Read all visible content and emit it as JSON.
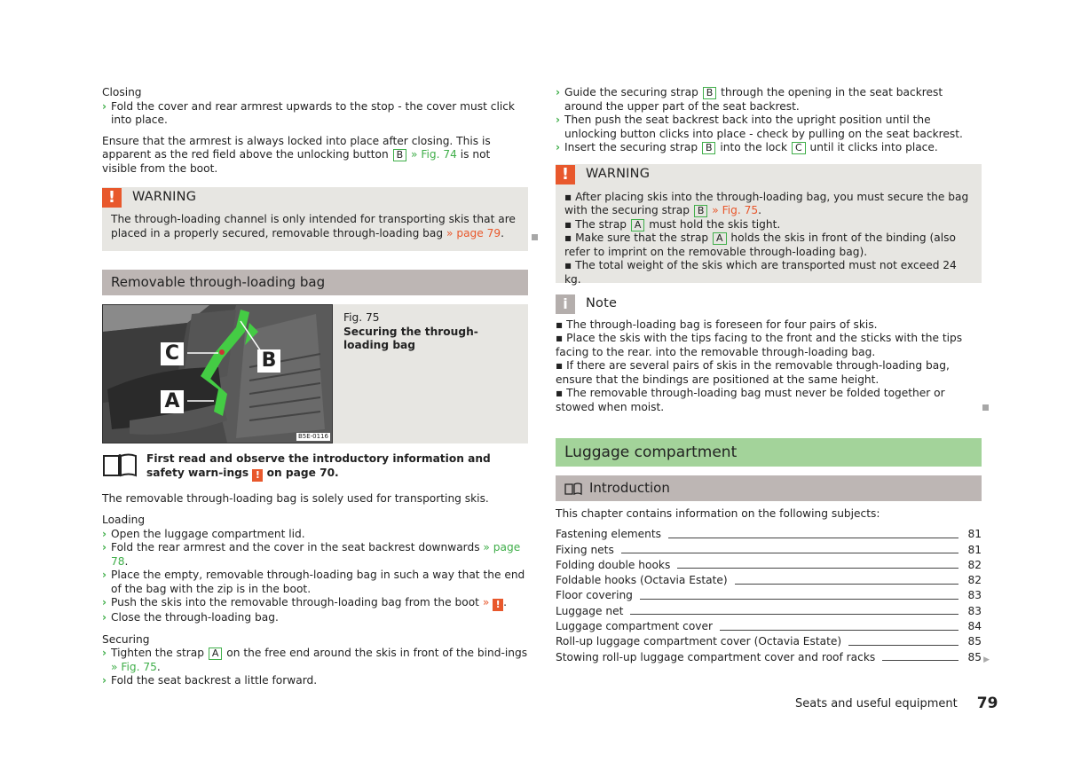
{
  "left": {
    "closing": {
      "heading": "Closing",
      "steps": [
        {
          "text": "Fold the cover and rear armrest upwards to the stop - the cover must click into place."
        }
      ],
      "para_before": "Ensure that the armrest is always locked into place after closing. This is apparent as the red field above the unlocking button ",
      "para_key": "B",
      "para_link": "» Fig. 74",
      "para_after": " is not visible from the boot."
    },
    "warning1": {
      "title": "WARNING",
      "text_before": "The through-loading channel is only intended for transporting skis that are placed in a properly secured, removable through-loading bag ",
      "link": "» page 79",
      "text_after": "."
    },
    "section_title": "Removable through-loading bag",
    "figure": {
      "number": "Fig. 75",
      "caption": "Securing the through-loading bag",
      "labels": [
        "C",
        "B",
        "A"
      ],
      "code": "B5E-0116"
    },
    "intro_note": {
      "text_before": "First read and observe the introductory information and safety warn-ings ",
      "text_after": " on page 70."
    },
    "solely_used": "The removable through-loading bag is solely used for transporting skis.",
    "loading": {
      "heading": "Loading",
      "steps": [
        {
          "text": "Open the luggage compartment lid."
        },
        {
          "text": "Fold the rear armrest and the cover in the seat backrest downwards ",
          "link": "» page 78",
          "after": "."
        },
        {
          "text": "Place the empty, removable through-loading bag in such a way that the end of the bag with the zip is in the boot."
        },
        {
          "text": "Push the skis into the removable through-loading bag from the boot ",
          "link": "»",
          "after": "."
        },
        {
          "text": "Close the through-loading bag."
        }
      ]
    },
    "securing": {
      "heading": "Securing",
      "step1_before": "Tighten the strap ",
      "step1_key": "A",
      "step1_after": " on the free end around the skis in front of the bind-ings ",
      "step1_link": "» Fig. 75",
      "step1_end": ".",
      "step2": "Fold the seat backrest a little forward."
    }
  },
  "right": {
    "steps": {
      "s1_before": "Guide the securing strap ",
      "s1_key": "B",
      "s1_after": " through the opening in the seat backrest around the upper part of the seat backrest.",
      "s2": "Then push the seat backrest back into the upright position until the unlocking button clicks into place - check by pulling on the seat backrest.",
      "s3_before": "Insert the securing strap ",
      "s3_key1": "B",
      "s3_mid": " into the lock ",
      "s3_key2": "C",
      "s3_after": " until it clicks into place."
    },
    "warning2": {
      "title": "WARNING",
      "b1_before": "After placing skis into the through-loading bag, you must secure the bag with the securing strap ",
      "b1_key": "B",
      "b1_link": "» Fig. 75",
      "b1_end": ".",
      "b2_before": "The strap ",
      "b2_key": "A",
      "b2_after": " must hold the skis tight.",
      "b3_before": "Make sure that the strap ",
      "b3_key": "A",
      "b3_after": " holds the skis in front of the binding (also refer to imprint on the removable through-loading bag).",
      "b4": "The total weight of the skis which are transported must not exceed 24 kg."
    },
    "note": {
      "title": "Note",
      "items": [
        "The through-loading bag is foreseen for four pairs of skis.",
        "Place the skis with the tips facing to the front and the sticks with the tips facing to the rear. into the removable through-loading bag.",
        "If there are several pairs of skis in the removable through-loading bag, ensure that the bindings are positioned at the same height.",
        "The removable through-loading bag must never be folded together or stowed when moist."
      ]
    },
    "chapter_title": "Luggage compartment",
    "intro_title": "Introduction",
    "intro_text": "This chapter contains information on the following subjects:",
    "toc": [
      {
        "title": "Fastening elements",
        "page": "81"
      },
      {
        "title": "Fixing nets",
        "page": "81"
      },
      {
        "title": "Folding double hooks",
        "page": "82"
      },
      {
        "title": "Foldable hooks (Octavia Estate)",
        "page": "82"
      },
      {
        "title": "Floor covering",
        "page": "83"
      },
      {
        "title": "Luggage net",
        "page": "83"
      },
      {
        "title": "Luggage compartment cover",
        "page": "84"
      },
      {
        "title": "Roll-up luggage compartment cover (Octavia Estate)",
        "page": "85"
      },
      {
        "title": "Stowing roll-up luggage compartment cover and roof racks",
        "page": "85"
      }
    ]
  },
  "footer": {
    "section": "Seats and useful equipment",
    "page_number": "79"
  },
  "colors": {
    "accent_green": "#3fae49",
    "warning_orange": "#e8582c",
    "chapter_bar": "#a3d39a",
    "section_bar": "#bdb6b4",
    "box_bg": "#e7e6e2"
  }
}
